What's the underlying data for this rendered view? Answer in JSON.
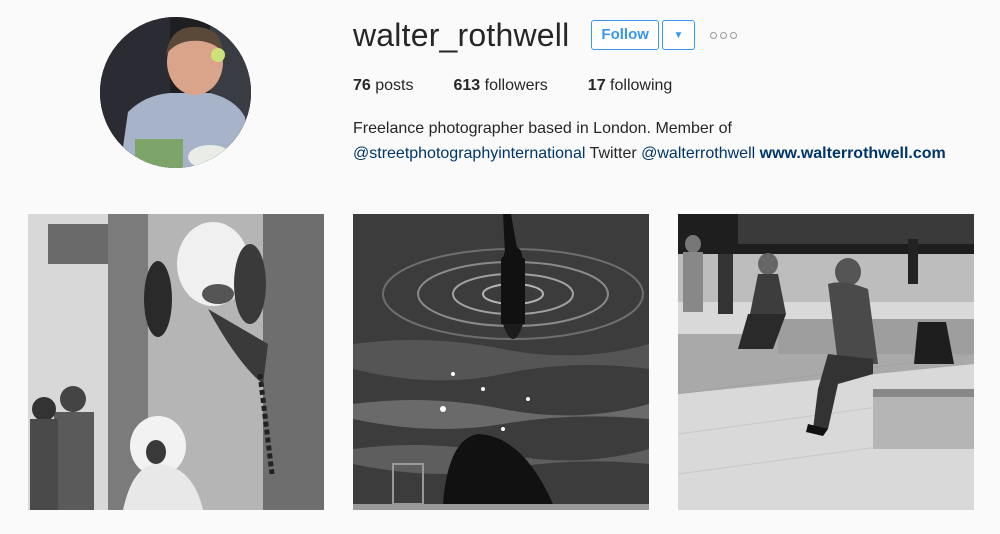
{
  "profile": {
    "username": "walter_rothwell",
    "follow_label": "Follow",
    "dropdown_icon": "caret-down-icon",
    "more_icon": "ellipsis-icon",
    "stats": {
      "posts_count": "76",
      "posts_label": "posts",
      "followers_count": "613",
      "followers_label": "followers",
      "following_count": "17",
      "following_label": "following"
    },
    "bio": {
      "line1": "Freelance photographer based in London. Member of",
      "mention1": "@streetphotographyinternational",
      "twitter_label": "Twitter",
      "mention2": "@walterrothwell",
      "website": "www.walterrothwell.com"
    }
  },
  "colors": {
    "accent": "#3897f0",
    "link": "#003569",
    "background": "#fafafa"
  }
}
